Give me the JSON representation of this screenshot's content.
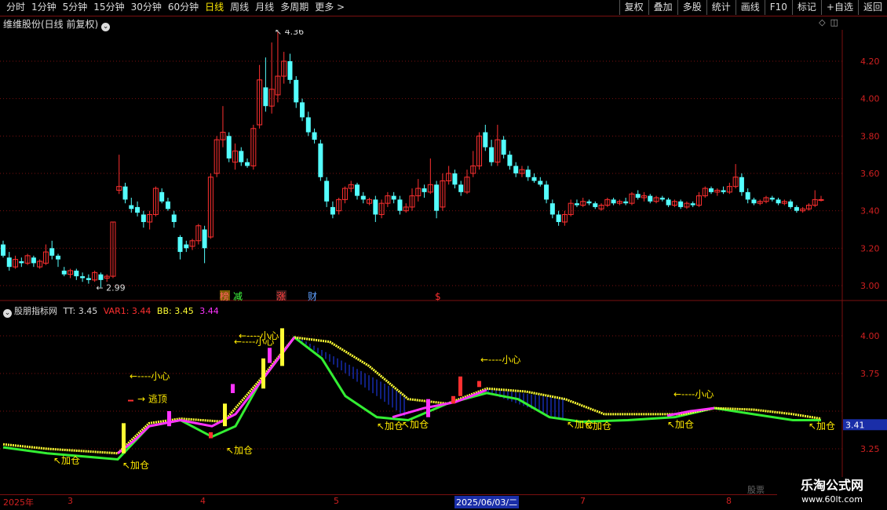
{
  "toolbar": {
    "periods": [
      "分时",
      "1分钟",
      "5分钟",
      "15分钟",
      "30分钟",
      "60分钟",
      "日线",
      "周线",
      "月线",
      "多周期",
      "更多 >"
    ],
    "active": "日线",
    "right": [
      "复权",
      "叠加",
      "多股",
      "统计",
      "画线",
      "F10",
      "标记",
      "+自选",
      "返回"
    ]
  },
  "stock_title": "维维股份(日线 前复权)",
  "indicator": {
    "name": "股朋指标网",
    "tt": "TT: 3.45",
    "var1": "VAR1: 3.44",
    "bb": "BB: 3.45",
    "last": "3.44"
  },
  "price_axis": [
    "4.20",
    "4.00",
    "3.80",
    "3.60",
    "3.40",
    "3.20",
    "3.00"
  ],
  "ind_axis": [
    "4.00",
    "3.75",
    "3.25"
  ],
  "ind_current": "3.41",
  "high_label": "4.36",
  "low_label": "2.99",
  "markers": [
    {
      "text": "榜",
      "color": "#ff6060",
      "bg": "#7a5a00"
    },
    {
      "text": "减",
      "color": "#40ff40",
      "bg": ""
    },
    {
      "text": "涨",
      "color": "#ff4040",
      "bg": "#3a1a1a"
    },
    {
      "text": "财",
      "color": "#60a0ff",
      "bg": ""
    },
    {
      "text": "$",
      "color": "#ff3030",
      "bg": ""
    }
  ],
  "annotations": {
    "xiaoxin": "←----小心",
    "taoding": "→ 逃顶",
    "jiacang": "↖加仓"
  },
  "dates": [
    "2025年",
    "3",
    "4",
    "5",
    "2025/06/03/二",
    "7",
    "8"
  ],
  "gupiao": "股票",
  "watermark": {
    "line1": "乐淘公式网",
    "line2": "www.60lt.com"
  },
  "colors": {
    "up": "#ff3030",
    "down": "#54ffff",
    "yellow": "#ffff33",
    "green": "#33ee33",
    "magenta": "#ff33ff"
  }
}
